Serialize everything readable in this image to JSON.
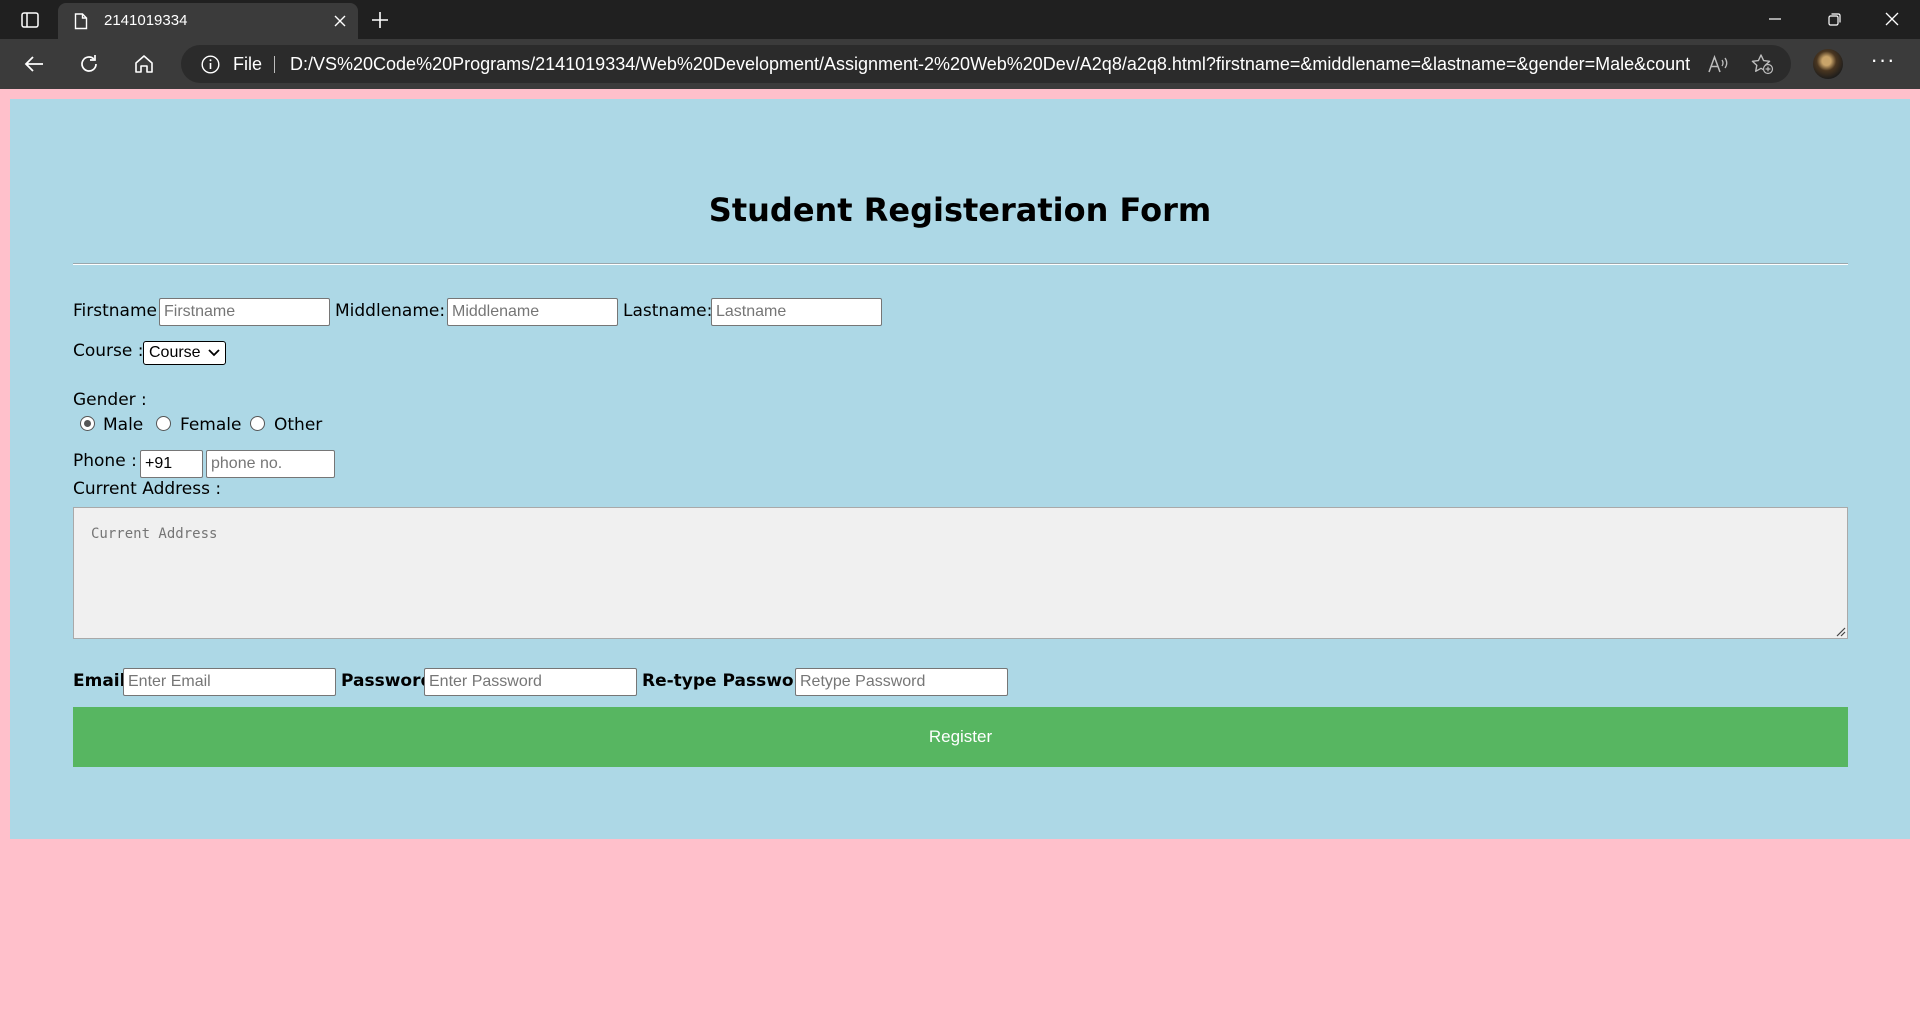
{
  "browser": {
    "tab_title": "2141019334",
    "address_scheme_label": "File",
    "address_url": "D:/VS%20Code%20Programs/2141019334/Web%20Development/Assignment-2%20Web%20Dev/A2q8/a2q8.html?firstname=&middlename=&lastname=&gender=Male&country..."
  },
  "form": {
    "title": "Student Registeration Form",
    "firstname": {
      "label": "Firstname:",
      "placeholder": "Firstname"
    },
    "middlename": {
      "label": "Middlename:",
      "placeholder": "Middlename"
    },
    "lastname": {
      "label": "Lastname:",
      "placeholder": "Lastname"
    },
    "course": {
      "label": "Course :",
      "selected": "Course"
    },
    "gender": {
      "label": "Gender :",
      "options": [
        "Male",
        "Female",
        "Other"
      ],
      "selected": "Male"
    },
    "phone": {
      "label": "Phone :",
      "code_value": "+91",
      "placeholder": "phone no."
    },
    "address": {
      "label": "Current Address :",
      "placeholder": "Current Address"
    },
    "email": {
      "label": "Email",
      "placeholder": "Enter Email"
    },
    "password": {
      "label": "Password",
      "placeholder": "Enter Password"
    },
    "retype": {
      "label": "Re-type Password",
      "placeholder": "Retype Password"
    },
    "register_label": "Register"
  },
  "colors": {
    "page_background": "#ffc0cb",
    "form_background": "#add8e6",
    "register_button": "#57b661"
  },
  "icons": {
    "tab_actions": "tab-actions-icon",
    "tab_document": "document-icon",
    "tab_close": "close-icon",
    "new_tab": "plus-icon",
    "back": "back-arrow-icon",
    "refresh": "refresh-icon",
    "home": "home-icon",
    "site_info": "info-icon",
    "read_aloud": "read-aloud-icon",
    "favorites": "add-favorite-icon",
    "more": "more-icon"
  }
}
